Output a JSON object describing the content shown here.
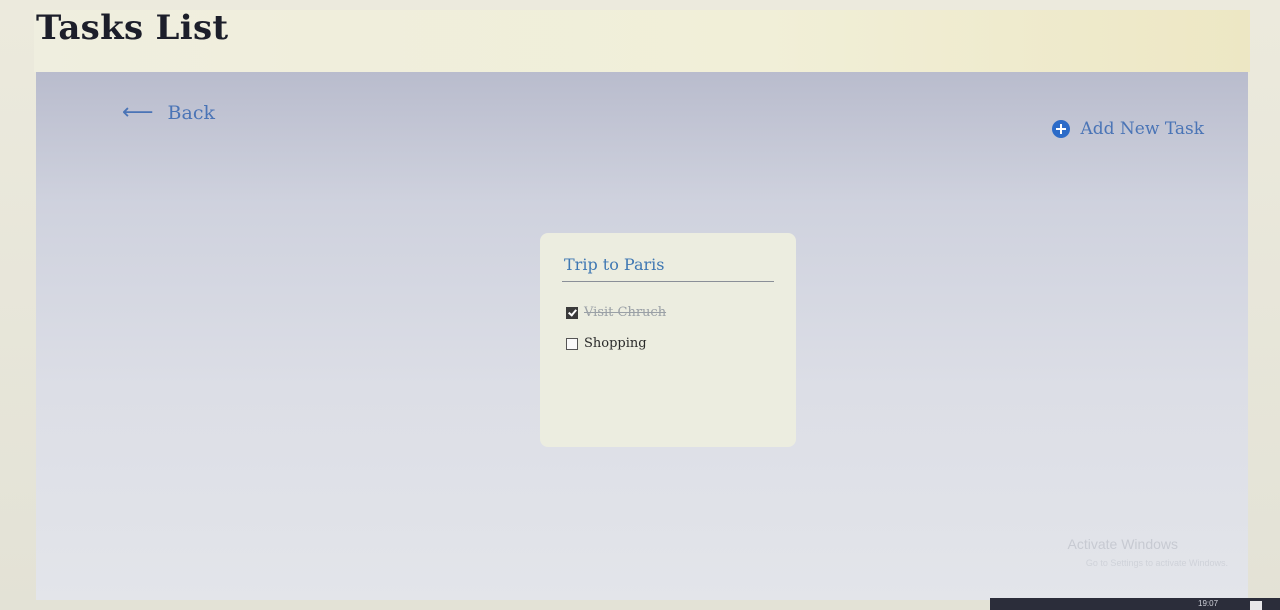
{
  "header": {
    "title": "Tasks List"
  },
  "nav": {
    "back_label": "Back",
    "back_icon": "left-arrow-icon",
    "add_task_label": "Add New Task",
    "add_task_icon": "plus-circle-icon"
  },
  "card": {
    "title": "Trip to Paris",
    "tasks": [
      {
        "label": "Visit Chruch",
        "done": true
      },
      {
        "label": "Shopping",
        "done": false
      }
    ]
  },
  "watermark": {
    "title": "Activate Windows",
    "subtitle": "Go to Settings to activate Windows."
  },
  "taskbar": {
    "clock": "19:07"
  },
  "colors": {
    "link": "#4a74b6",
    "title": "#1c1e2a",
    "card_title": "#3f78b3",
    "add_icon": "#2c6bc8"
  }
}
